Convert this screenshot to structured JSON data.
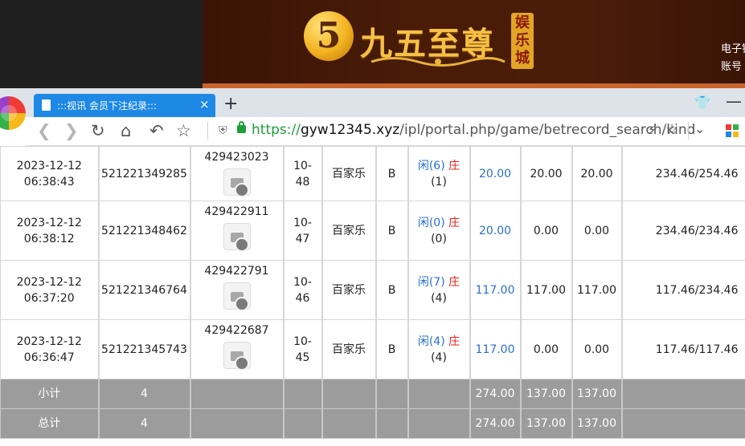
{
  "banner": {
    "logo_badge": "5",
    "logo_title": "九五至尊",
    "logo_vertical": "娱乐城",
    "right_text_1": "电子银",
    "right_text_2": "账号"
  },
  "browser": {
    "tab_title": ":::视讯 会员下注纪录:::",
    "tab_close": "×",
    "new_tab": "+",
    "url_scheme": "https://",
    "url_host": "gyw12345.xyz",
    "url_path": "/ipl/portal.php/game/betrecord_search/kind"
  },
  "records": [
    {
      "date": "2023-12-12",
      "time": "06:38:43",
      "order_no": "521221349285",
      "round_id": "429423023",
      "table_top": "10-",
      "table_bottom": "48",
      "game": "百家乐",
      "bet_side": "B",
      "result_player": "闲(6)",
      "result_banker": "庄",
      "result_banker_pts": "(1)",
      "bet_amount": "20.00",
      "valid_amount": "20.00",
      "payout": "20.00",
      "balance": "234.46/254.46"
    },
    {
      "date": "2023-12-12",
      "time": "06:38:12",
      "order_no": "521221348462",
      "round_id": "429422911",
      "table_top": "10-",
      "table_bottom": "47",
      "game": "百家乐",
      "bet_side": "B",
      "result_player": "闲(0)",
      "result_banker": "庄",
      "result_banker_pts": "(0)",
      "bet_amount": "20.00",
      "valid_amount": "0.00",
      "payout": "0.00",
      "balance": "234.46/234.46"
    },
    {
      "date": "2023-12-12",
      "time": "06:37:20",
      "order_no": "521221346764",
      "round_id": "429422791",
      "table_top": "10-",
      "table_bottom": "46",
      "game": "百家乐",
      "bet_side": "B",
      "result_player": "闲(7)",
      "result_banker": "庄",
      "result_banker_pts": "(4)",
      "bet_amount": "117.00",
      "valid_amount": "117.00",
      "payout": "117.00",
      "balance": "117.46/234.46"
    },
    {
      "date": "2023-12-12",
      "time": "06:36:47",
      "order_no": "521221345743",
      "round_id": "429422687",
      "table_top": "10-",
      "table_bottom": "45",
      "game": "百家乐",
      "bet_side": "B",
      "result_player": "闲(4)",
      "result_banker": "庄",
      "result_banker_pts": "(4)",
      "bet_amount": "117.00",
      "valid_amount": "0.00",
      "payout": "0.00",
      "balance": "117.46/117.46"
    }
  ],
  "subtotal": {
    "label": "小计",
    "count": "4",
    "bet_amount": "274.00",
    "valid_amount": "137.00",
    "payout": "137.00"
  },
  "total": {
    "label": "总计",
    "count": "4",
    "bet_amount": "274.00",
    "valid_amount": "137.00",
    "payout": "137.00"
  },
  "colors": {
    "tab_blue": "#1e88e5",
    "secure_green": "#1e9e3b",
    "amount_blue": "#2a6fcb",
    "banker_red": "#e5231b",
    "summary_gray": "#9c9c9c"
  }
}
